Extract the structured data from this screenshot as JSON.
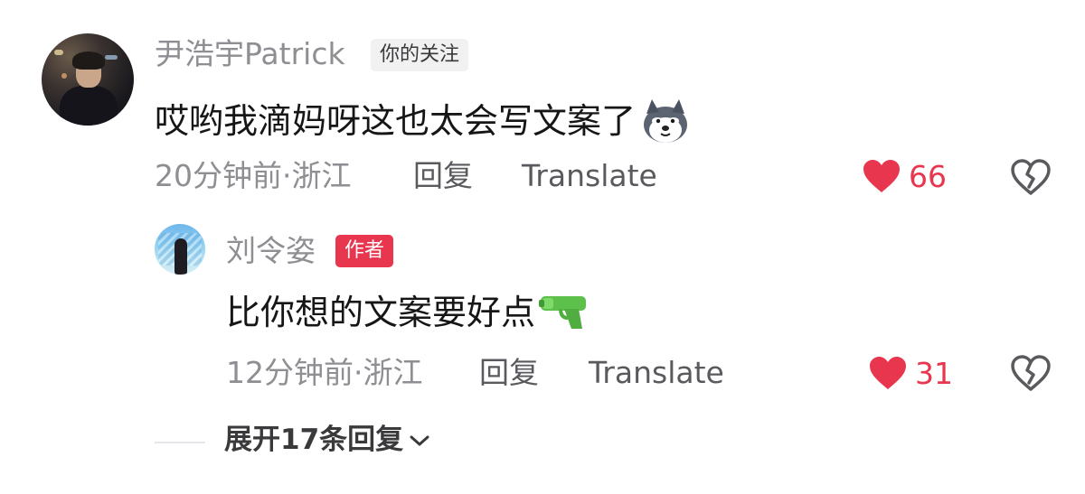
{
  "comment": {
    "author": "尹浩宇Patrick",
    "badge": "你的关注",
    "text": "哎哟我滴妈呀这也太会写文案了",
    "emoji": "husky-emoji",
    "meta": "20分钟前·浙江",
    "reply_label": "回复",
    "translate_label": "Translate",
    "likes": "66",
    "liked": true
  },
  "reply": {
    "author": "刘令姿",
    "badge": "作者",
    "text": "比你想的文案要好点",
    "emoji": "water-pistol-emoji",
    "meta": "12分钟前·浙江",
    "reply_label": "回复",
    "translate_label": "Translate",
    "likes": "31",
    "liked": true
  },
  "expand": {
    "label": "展开17条回复"
  },
  "colors": {
    "accent_red": "#e8364f",
    "meta_gray": "#8e8e93",
    "text": "#161616"
  }
}
